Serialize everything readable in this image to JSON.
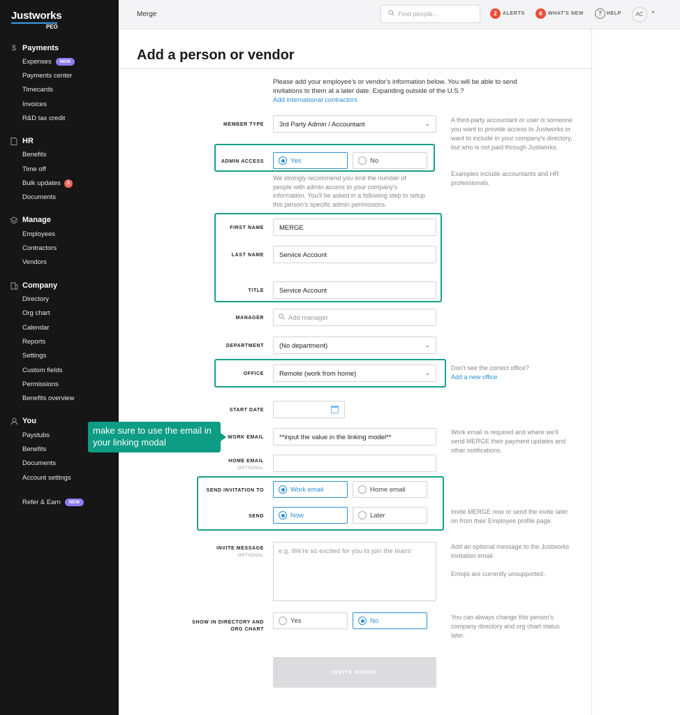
{
  "sidebar": {
    "logo": "Justworks",
    "logo_sub": "PEO",
    "sections": {
      "payments": {
        "title": "Payments",
        "icon": "dollar-icon",
        "items": {
          "expenses": "Expenses",
          "expenses_badge": "NEW",
          "payments_center": "Payments center",
          "timecards": "Timecards",
          "invoices": "Invoices",
          "rd_tax_credit": "R&D tax credit"
        }
      },
      "hr": {
        "title": "HR",
        "icon": "document-icon",
        "items": {
          "benefits": "Benefits",
          "time_off": "Time off",
          "bulk_updates": "Bulk updates",
          "bulk_updates_count": "1",
          "documents": "Documents"
        }
      },
      "manage": {
        "title": "Manage",
        "icon": "layers-icon",
        "items": {
          "employees": "Employees",
          "contractors": "Contractors",
          "vendors": "Vendors"
        }
      },
      "company": {
        "title": "Company",
        "icon": "building-icon",
        "items": {
          "directory": "Directory",
          "org_chart": "Org chart",
          "calendar": "Calendar",
          "reports": "Reports",
          "settings": "Settings",
          "custom_fields": "Custom fields",
          "permissions": "Permissions",
          "benefits_overview": "Benefits overview"
        }
      },
      "you": {
        "title": "You",
        "icon": "person-icon",
        "items": {
          "paystubs": "Paystubs",
          "benefits": "Benefits",
          "documents": "Documents",
          "account_settings": "Account settings"
        }
      }
    },
    "refer": {
      "label": "Refer & Earn",
      "badge": "NEW"
    }
  },
  "topbar": {
    "breadcrumb": "Merge",
    "search_placeholder": "Find people...",
    "alerts_count": "2",
    "alerts_label": "ALERTS",
    "whats_new_count": "6",
    "whats_new_label": "WHAT'S NEW",
    "help_label": "HELP",
    "avatar_initials": "AC"
  },
  "page": {
    "title": "Add a person or vendor",
    "intro": "Please add your employee's or vendor's information below. You will be able to send invitations to them at a later date. Expanding outside of the U.S.?",
    "intro_link": "Add international contractors"
  },
  "form": {
    "member_type": {
      "label": "MEMBER TYPE",
      "value": "3rd Party Admin / Accountant",
      "help": "A third-party accountant or user is someone you want to provide access to Justworks or want to include in your company's directory, but who is not paid through Justworks.",
      "help2": "Examples include accountants and HR professionals."
    },
    "admin_access": {
      "label": "ADMIN ACCESS",
      "yes": "Yes",
      "no": "No",
      "selected": "Yes",
      "hint": "We strongly recommend you limit the number of people with admin access to your company's information. You'll be asked in a following step to setup this person's specific admin permissions."
    },
    "first_name": {
      "label": "FIRST NAME",
      "value": "MERGE"
    },
    "last_name": {
      "label": "LAST NAME",
      "value": "Service Account"
    },
    "title": {
      "label": "TITLE",
      "value": "Service Account"
    },
    "manager": {
      "label": "MANAGER",
      "placeholder": "Add manager"
    },
    "department": {
      "label": "DEPARTMENT",
      "value": "(No department)"
    },
    "office": {
      "label": "OFFICE",
      "value": "Remote (work from home)",
      "help": "Don't see the correct office?",
      "help_link": "Add a new office"
    },
    "start_date": {
      "label": "START DATE"
    },
    "work_email": {
      "label": "WORK EMAIL",
      "value": "**input the value in the linking model**",
      "help": "Work email is required and where we'll send MERGE their payment updates and other notifications."
    },
    "home_email": {
      "label": "HOME EMAIL",
      "optional": "OPTIONAL"
    },
    "send_invitation_to": {
      "label": "SEND INVITATION TO",
      "work": "Work email",
      "home": "Home email",
      "selected": "Work email"
    },
    "send": {
      "label": "SEND",
      "now": "Now",
      "later": "Later",
      "selected": "Now",
      "help": "Invite MERGE now or send the invite later on from their Employee profile page."
    },
    "invite_message": {
      "label": "INVITE MESSAGE",
      "optional": "OPTIONAL",
      "placeholder": "e.g. We're so excited for you to join the team!",
      "help": "Add an optional message to the Justworks invitation email.",
      "help2": "Emojis are currently unsupported."
    },
    "show_in_directory": {
      "label": "SHOW IN DIRECTORY AND",
      "label2": "ORG CHART",
      "yes": "Yes",
      "no": "No",
      "selected": "No",
      "help": "You can always change this person's company directory and org chart status later."
    },
    "submit": "INVITE MERGE"
  },
  "callout": {
    "text": "make sure to use the email in your linking modal"
  },
  "colors": {
    "sidebar_bg": "#161616",
    "accent_blue": "#2b8fd6",
    "highlight_teal": "#16a08a",
    "badge_red": "#e94e3c",
    "badge_purple": "#8f7cf2"
  }
}
